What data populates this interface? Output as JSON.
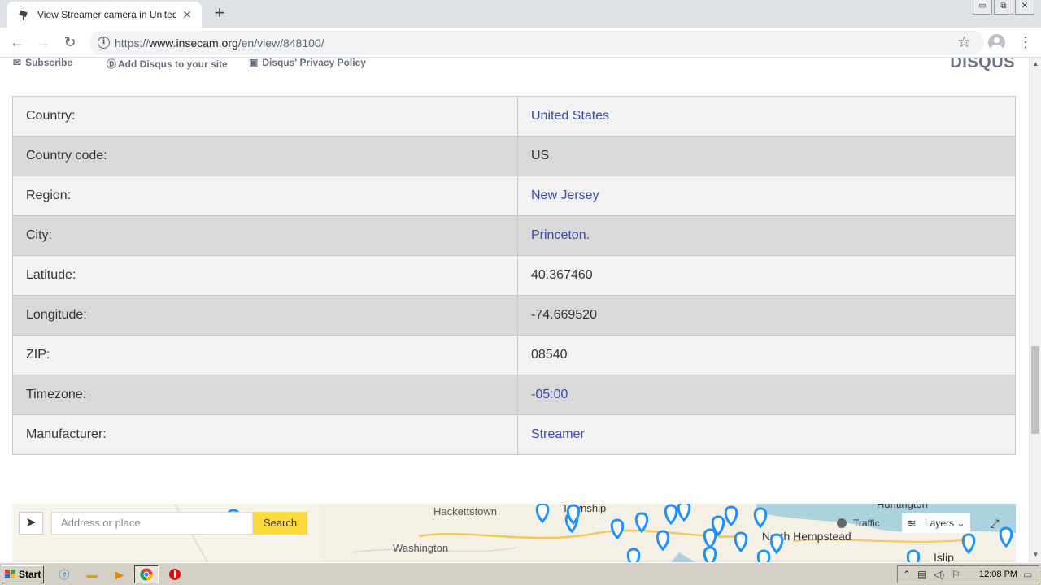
{
  "browser": {
    "tab_title": "View Streamer camera in United States",
    "tab_close": "✕",
    "new_tab": "+",
    "url_prefix": "https://",
    "url_host": "www.insecam.org",
    "url_path": "/en/view/848100/",
    "window_buttons": [
      "▭",
      "⧉",
      "✕"
    ]
  },
  "disqus": {
    "subscribe": "Subscribe",
    "add_disqus": "Add Disqus to your site",
    "privacy": "Disqus' Privacy Policy",
    "logo": "DISQUS"
  },
  "details": [
    {
      "label": "Country:",
      "value": "United States",
      "link": true
    },
    {
      "label": "Country code:",
      "value": "US",
      "link": false
    },
    {
      "label": "Region:",
      "value": "New Jersey",
      "link": true
    },
    {
      "label": "City:",
      "value": "Princeton.",
      "link": true
    },
    {
      "label": "Latitude:",
      "value": "40.367460",
      "link": false
    },
    {
      "label": "Longitude:",
      "value": "-74.669520",
      "link": false
    },
    {
      "label": "ZIP:",
      "value": "08540",
      "link": false
    },
    {
      "label": "Timezone:",
      "value": "-05:00",
      "link": true
    },
    {
      "label": "Manufacturer:",
      "value": "Streamer",
      "link": true
    }
  ],
  "map": {
    "address_placeholder": "Address or place",
    "search_label": "Search",
    "traffic_label": "Traffic",
    "layers_label": "Layers",
    "places": [
      "Hackettstown",
      "Washington",
      "North Hempstead",
      "Islip",
      "Huntington",
      "Township"
    ],
    "marker_color": "#1e90ff"
  },
  "taskbar": {
    "start_label": "Start",
    "clock": "12:08 PM"
  }
}
